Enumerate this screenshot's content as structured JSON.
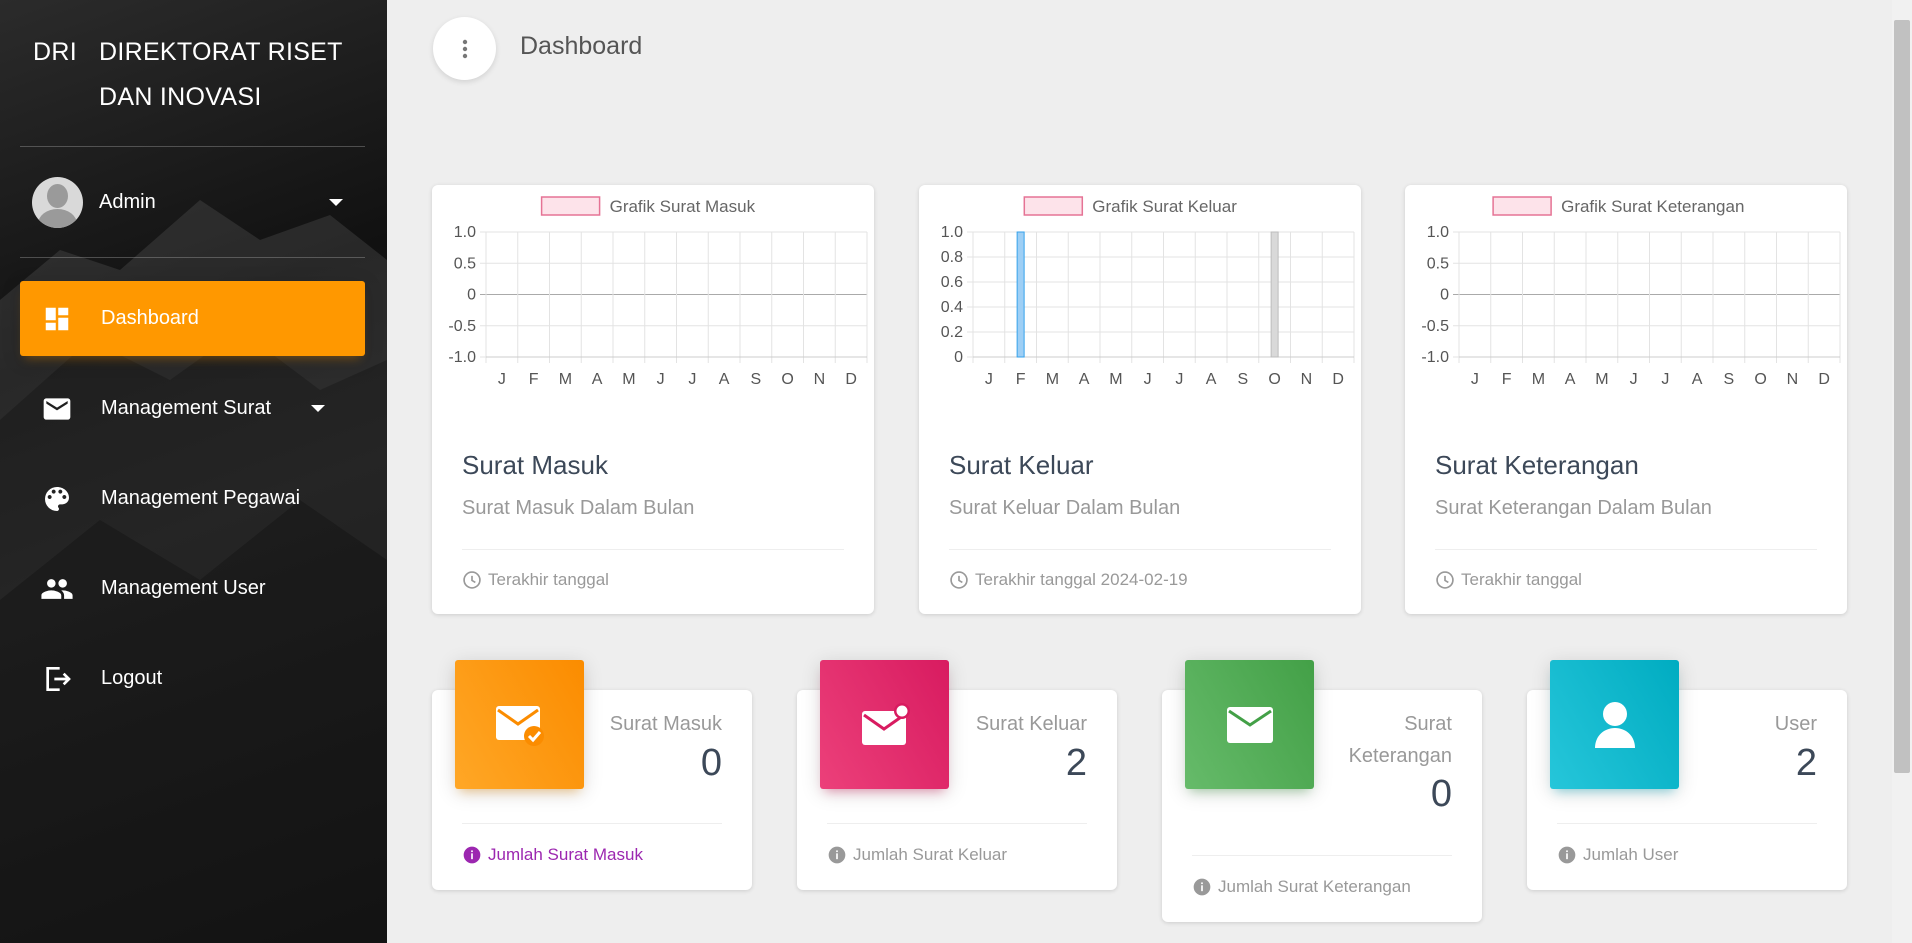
{
  "brand": {
    "mini": "DRI",
    "full": "DIREKTORAT RISET DAN INOVASI"
  },
  "user": {
    "name": "Admin"
  },
  "nav": [
    {
      "label": "Dashboard",
      "icon": "dashboard-icon",
      "active": true
    },
    {
      "label": "Management Surat",
      "icon": "mail-icon",
      "dropdown": true
    },
    {
      "label": "Management Pegawai",
      "icon": "palette-icon"
    },
    {
      "label": "Management User",
      "icon": "people-icon"
    },
    {
      "label": "Logout",
      "icon": "logout-icon"
    }
  ],
  "header": {
    "title": "Dashboard"
  },
  "colors": {
    "accent": "#ff9800",
    "pink": "#e91e63",
    "green": "#4caf50",
    "cyan": "#00bcd4",
    "purple": "#9c27b0"
  },
  "chart_cards": [
    {
      "title": "Surat Masuk",
      "category": "Surat Masuk Dalam Bulan",
      "footer": "Terakhir tanggal"
    },
    {
      "title": "Surat Keluar",
      "category": "Surat Keluar Dalam Bulan",
      "footer": "Terakhir tanggal 2024-02-19"
    },
    {
      "title": "Surat Keterangan",
      "category": "Surat Keterangan Dalam Bulan",
      "footer": "Terakhir tanggal"
    }
  ],
  "chart_data": [
    {
      "type": "bar",
      "legend": "Grafik Surat Masuk",
      "categories": [
        "J",
        "F",
        "M",
        "A",
        "M",
        "J",
        "J",
        "A",
        "S",
        "O",
        "N",
        "D"
      ],
      "values": [
        0,
        0,
        0,
        0,
        0,
        0,
        0,
        0,
        0,
        0,
        0,
        0
      ],
      "ylim": [
        -1.0,
        1.0
      ],
      "yticks": [
        "1.0",
        "0.5",
        "0",
        "-0.5",
        "-1.0"
      ],
      "grid": true,
      "legend_position": "top"
    },
    {
      "type": "bar",
      "legend": "Grafik Surat Keluar",
      "categories": [
        "J",
        "F",
        "M",
        "A",
        "M",
        "J",
        "J",
        "A",
        "S",
        "O",
        "N",
        "D"
      ],
      "values": [
        0,
        1,
        0,
        0,
        0,
        0,
        0,
        0,
        0,
        1,
        0,
        0
      ],
      "bar_colors": [
        "",
        "#9ecff5",
        "",
        "",
        "",
        "",
        "",
        "",
        "",
        "#d9d9d9",
        "",
        ""
      ],
      "ylim": [
        0,
        1.0
      ],
      "yticks": [
        "1.0",
        "0.8",
        "0.6",
        "0.4",
        "0.2",
        "0"
      ],
      "grid": true,
      "legend_position": "top"
    },
    {
      "type": "bar",
      "legend": "Grafik Surat Keterangan",
      "categories": [
        "J",
        "F",
        "M",
        "A",
        "M",
        "J",
        "J",
        "A",
        "S",
        "O",
        "N",
        "D"
      ],
      "values": [
        0,
        0,
        0,
        0,
        0,
        0,
        0,
        0,
        0,
        0,
        0,
        0
      ],
      "ylim": [
        -1.0,
        1.0
      ],
      "yticks": [
        "1.0",
        "0.5",
        "0",
        "-0.5",
        "-1.0"
      ],
      "grid": true,
      "legend_position": "top"
    }
  ],
  "stats": [
    {
      "label": "Surat Masuk",
      "value": "0",
      "footer": "Jumlah Surat Masuk",
      "icon": "mail-check-icon"
    },
    {
      "label": "Surat Keluar",
      "value": "2",
      "footer": "Jumlah Surat Keluar",
      "icon": "mail-notification-icon"
    },
    {
      "label_line1": "Surat",
      "label_line2": "Keterangan",
      "value": "0",
      "footer": "Jumlah Surat Keterangan",
      "icon": "mail-icon"
    },
    {
      "label": "User",
      "value": "2",
      "footer": "Jumlah User",
      "icon": "person-icon"
    }
  ]
}
